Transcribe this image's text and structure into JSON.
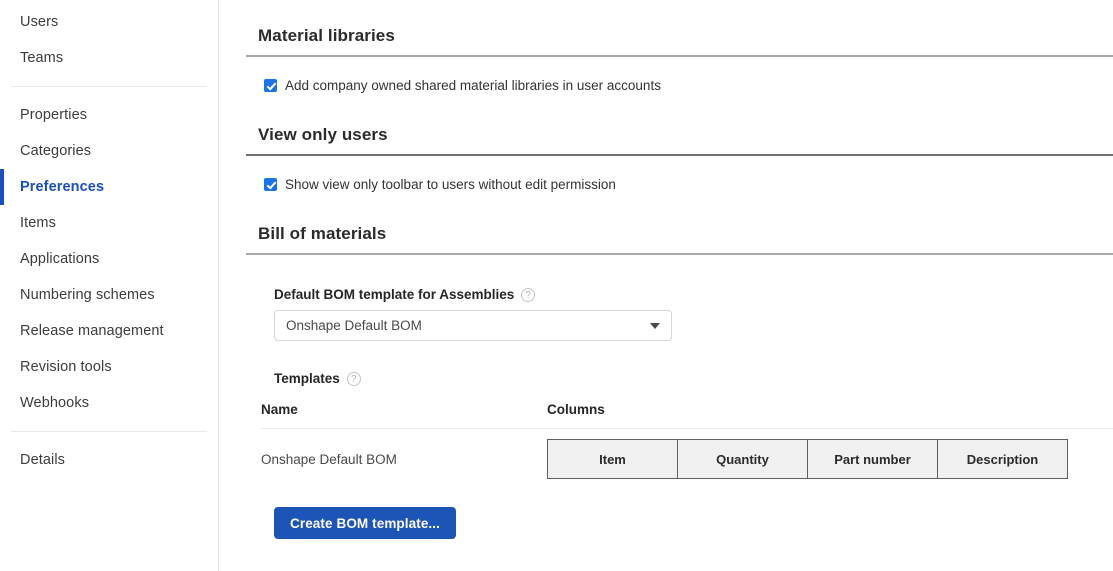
{
  "sidebar": {
    "groups": [
      {
        "items": [
          {
            "label": "Users",
            "active": false
          },
          {
            "label": "Teams",
            "active": false
          }
        ]
      },
      {
        "items": [
          {
            "label": "Properties",
            "active": false
          },
          {
            "label": "Categories",
            "active": false
          },
          {
            "label": "Preferences",
            "active": true
          },
          {
            "label": "Items",
            "active": false
          },
          {
            "label": "Applications",
            "active": false
          },
          {
            "label": "Numbering schemes",
            "active": false
          },
          {
            "label": "Release management",
            "active": false
          },
          {
            "label": "Revision tools",
            "active": false
          },
          {
            "label": "Webhooks",
            "active": false
          }
        ]
      },
      {
        "items": [
          {
            "label": "Details",
            "active": false
          }
        ]
      }
    ]
  },
  "sections": {
    "material_libraries": {
      "heading": "Material libraries",
      "checkbox": {
        "label": "Add company owned shared material libraries in user accounts",
        "checked": true
      }
    },
    "view_only_users": {
      "heading": "View only users",
      "checkbox": {
        "label": "Show view only toolbar to users without edit permission",
        "checked": true
      }
    },
    "bill_of_materials": {
      "heading": "Bill of materials",
      "default_template": {
        "label": "Default BOM template for Assemblies",
        "help_icon": "question-mark-icon",
        "selected_value": "Onshape Default BOM",
        "dropdown_icon": "chevron-down-icon"
      },
      "templates": {
        "label": "Templates",
        "help_icon": "question-mark-icon",
        "columns_headers": [
          "Name",
          "Columns"
        ],
        "rows": [
          {
            "name": "Onshape Default BOM",
            "columns": [
              "Item",
              "Quantity",
              "Part number",
              "Description"
            ]
          }
        ]
      },
      "create_button": "Create BOM template..."
    }
  },
  "colors": {
    "accent_blue": "#1a4fbf",
    "checkbox_blue": "#1a73e8",
    "button_blue": "#1c55b5",
    "rule_gray": "#a6a8ab",
    "cell_fill": "#f0f0f0"
  }
}
